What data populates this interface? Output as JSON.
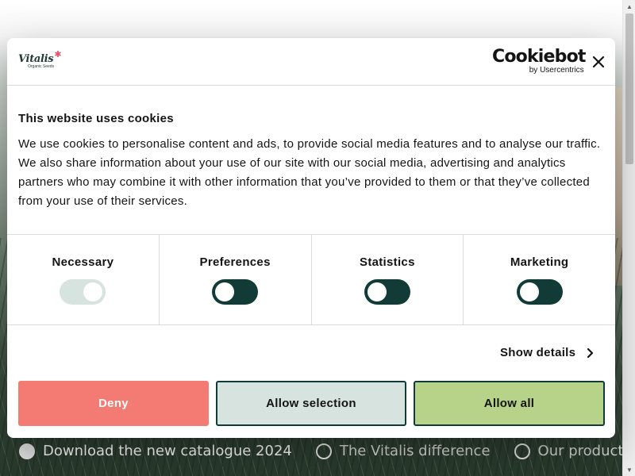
{
  "dialog": {
    "brand": {
      "name": "Vitalis",
      "subtitle": "Organic Seeds"
    },
    "provider": {
      "name": "Cookiebot",
      "byline": "by Usercentrics"
    },
    "title": "This website uses cookies",
    "text": "We use cookies to personalise content and ads, to provide social media features and to analyse our traffic. We also share information about your use of our site with our social media, advertising and analytics partners who may combine it with other information that you’ve provided to them or that they’ve collected from your use of their services.",
    "toggles": [
      {
        "label": "Necessary",
        "state": "on-disabled"
      },
      {
        "label": "Preferences",
        "state": "off"
      },
      {
        "label": "Statistics",
        "state": "off"
      },
      {
        "label": "Marketing",
        "state": "off"
      }
    ],
    "show_details": "Show details",
    "buttons": {
      "deny": "Deny",
      "allow_selection": "Allow selection",
      "allow_all": "Allow all"
    },
    "colors": {
      "deny": "#f37b73",
      "allow_selection": "#d6e3df",
      "allow_all": "#b6d389",
      "toggle_off": "#123a36"
    }
  },
  "background_nav": [
    {
      "label": "Download the new catalogue 2024"
    },
    {
      "label": "The Vitalis difference"
    },
    {
      "label": "Our products"
    }
  ]
}
